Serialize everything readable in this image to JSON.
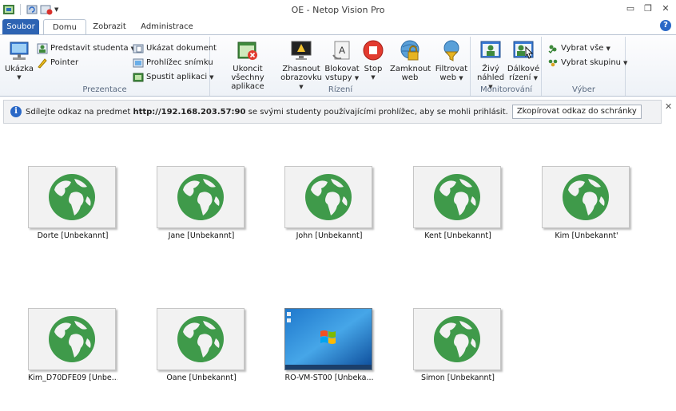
{
  "window": {
    "title": "OE - Netop Vision Pro"
  },
  "tabs": [
    {
      "label": "Soubor"
    },
    {
      "label": "Domu"
    },
    {
      "label": "Zobrazit"
    },
    {
      "label": "Administrace"
    }
  ],
  "help_label": "?",
  "ribbon": {
    "prezentace": {
      "label": "Prezentace",
      "ukazka": "Ukázka",
      "predstavit": "Predstavit studenta",
      "pointer": "Pointer",
      "ukazat_dokument": "Ukázat dokument",
      "prohlizec": "Prohlížec snímku",
      "spustit": "Spustit aplikaci"
    },
    "rizeni": {
      "label": "Rízení",
      "ukoncit_l1": "Ukoncit všechny",
      "ukoncit_l2": "aplikace",
      "zhasnout_l1": "Zhasnout",
      "zhasnout_l2": "obrazovku",
      "blokovat_l1": "Blokovat",
      "blokovat_l2": "vstupy",
      "stop": "Stop",
      "zamknout_l1": "Zamknout",
      "zamknout_l2": "web",
      "filtrovat_l1": "Filtrovat",
      "filtrovat_l2": "web"
    },
    "monitorovani": {
      "label": "Monitorování",
      "zivy_l1": "Živý",
      "zivy_l2": "náhled",
      "dalkove_l1": "Dálkové",
      "dalkove_l2": "rízení"
    },
    "vyber": {
      "label": "Výber",
      "vybrat_vse": "Vybrat vše",
      "vybrat_skupinu": "Vybrat skupinu"
    }
  },
  "infobar": {
    "text_before": "Sdílejte odkaz na predmet",
    "url": "http://192.168.203.57:90",
    "text_after": "se svými studenty používajícími prohlížec, aby se mohli prihlásit.",
    "copy_button": "Zkopírovat odkaz do schránky"
  },
  "students": [
    {
      "name": "Dorte [Unbekannt]",
      "screen": "globe"
    },
    {
      "name": "Jane [Unbekannt]",
      "screen": "globe"
    },
    {
      "name": "John [Unbekannt]",
      "screen": "globe"
    },
    {
      "name": "Kent [Unbekannt]",
      "screen": "globe"
    },
    {
      "name": "Kim [Unbekannt'",
      "screen": "globe"
    },
    {
      "name": "Kim_D70DFE09 [Unbe...",
      "screen": "globe"
    },
    {
      "name": "Oane [Unbekannt]",
      "screen": "globe"
    },
    {
      "name": "RO-VM-ST00 [Unbeka...",
      "screen": "desktop"
    },
    {
      "name": "Simon [Unbekannt]",
      "screen": "globe"
    }
  ]
}
